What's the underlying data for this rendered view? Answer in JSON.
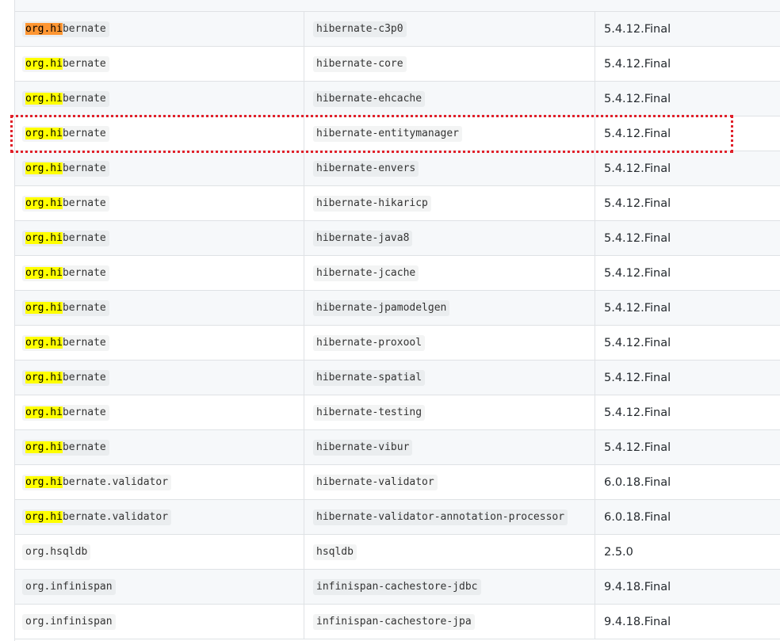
{
  "rows": [
    {
      "group_hl": "org.hi",
      "group_rest": "bernate",
      "artifact": "hibernate-c3p0",
      "version": "5.4.12.Final",
      "current": true
    },
    {
      "group_hl": "org.hi",
      "group_rest": "bernate",
      "artifact": "hibernate-core",
      "version": "5.4.12.Final"
    },
    {
      "group_hl": "org.hi",
      "group_rest": "bernate",
      "artifact": "hibernate-ehcache",
      "version": "5.4.12.Final"
    },
    {
      "group_hl": "org.hi",
      "group_rest": "bernate",
      "artifact": "hibernate-entitymanager",
      "version": "5.4.12.Final"
    },
    {
      "group_hl": "org.hi",
      "group_rest": "bernate",
      "artifact": "hibernate-envers",
      "version": "5.4.12.Final"
    },
    {
      "group_hl": "org.hi",
      "group_rest": "bernate",
      "artifact": "hibernate-hikaricp",
      "version": "5.4.12.Final"
    },
    {
      "group_hl": "org.hi",
      "group_rest": "bernate",
      "artifact": "hibernate-java8",
      "version": "5.4.12.Final"
    },
    {
      "group_hl": "org.hi",
      "group_rest": "bernate",
      "artifact": "hibernate-jcache",
      "version": "5.4.12.Final"
    },
    {
      "group_hl": "org.hi",
      "group_rest": "bernate",
      "artifact": "hibernate-jpamodelgen",
      "version": "5.4.12.Final"
    },
    {
      "group_hl": "org.hi",
      "group_rest": "bernate",
      "artifact": "hibernate-proxool",
      "version": "5.4.12.Final"
    },
    {
      "group_hl": "org.hi",
      "group_rest": "bernate",
      "artifact": "hibernate-spatial",
      "version": "5.4.12.Final"
    },
    {
      "group_hl": "org.hi",
      "group_rest": "bernate",
      "artifact": "hibernate-testing",
      "version": "5.4.12.Final"
    },
    {
      "group_hl": "org.hi",
      "group_rest": "bernate",
      "artifact": "hibernate-vibur",
      "version": "5.4.12.Final"
    },
    {
      "group_hl": "org.hi",
      "group_rest": "bernate.validator",
      "artifact": "hibernate-validator",
      "version": "6.0.18.Final"
    },
    {
      "group_hl": "org.hi",
      "group_rest": "bernate.validator",
      "artifact": "hibernate-validator-annotation-processor",
      "version": "6.0.18.Final"
    },
    {
      "group_hl": "",
      "group_rest": "org.hsqldb",
      "artifact": "hsqldb",
      "version": "2.5.0"
    },
    {
      "group_hl": "",
      "group_rest": "org.infinispan",
      "artifact": "infinispan-cachestore-jdbc",
      "version": "9.4.18.Final"
    },
    {
      "group_hl": "",
      "group_rest": "org.infinispan",
      "artifact": "infinispan-cachestore-jpa",
      "version": "9.4.18.Final"
    }
  ],
  "colors": {
    "highlight": "#ffff00",
    "current_highlight": "#ff9632",
    "marker": "#e0202a"
  }
}
